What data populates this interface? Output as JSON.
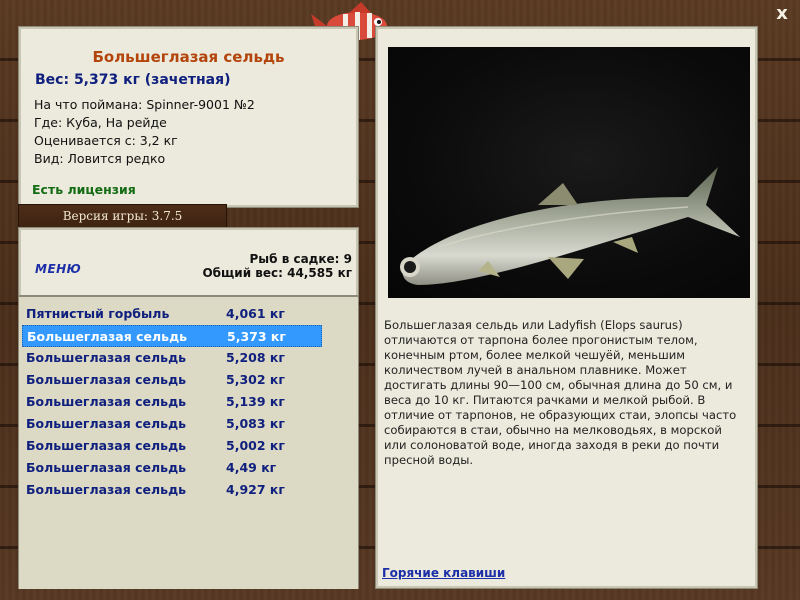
{
  "close_label": "x",
  "info": {
    "fish_name": "Большеглазая сельдь",
    "weight": "Вес: 5,373 кг (зачетная)",
    "lines": [
      "На что поймана: Spinner-9001 №2",
      "Где: Куба, На рейде",
      "Оценивается с: 3,2 кг",
      "Вид: Ловится редко"
    ],
    "license": "Есть лицензия"
  },
  "version": "Версия игры: 3.7.5",
  "menu_label": "МЕНЮ",
  "cage": {
    "count": "Рыб в садке: 9",
    "total": "Общий вес: 44,585 кг"
  },
  "catch_list": [
    {
      "name": "Пятнистый горбыль",
      "weight": "4,061 кг"
    },
    {
      "name": "Большеглазая сельдь",
      "weight": "5,373 кг"
    },
    {
      "name": "Большеглазая сельдь",
      "weight": "5,208 кг"
    },
    {
      "name": "Большеглазая сельдь",
      "weight": "5,302 кг"
    },
    {
      "name": "Большеглазая сельдь",
      "weight": "5,139 кг"
    },
    {
      "name": "Большеглазая сельдь",
      "weight": "5,083 кг"
    },
    {
      "name": "Большеглазая сельдь",
      "weight": "5,002 кг"
    },
    {
      "name": "Большеглазая сельдь",
      "weight": "4,49 кг"
    },
    {
      "name": "Большеглазая сельдь",
      "weight": "4,927 кг"
    }
  ],
  "selected_index": 1,
  "description": "Большеглазая сельдь или Ladyfish (Elops saurus) отличаются от тарпона более прогонистым телом, конечным ртом, более мелкой чешуёй, меньшим количеством лучей в анальном плавнике. Может достигать длины 90—100 см, обычная длина до 50 см, и веса до 10 кг. Питаются рачками и мелкой рыбой. В отличие от тарпонов, не образующих стаи, элопсы часто собираются в стаи, обычно на мелководьях, в морской или солоноватой воде, иногда заходя в реки до почти пресной воды.",
  "hotkeys_label": "Горячие клавиши",
  "colors": {
    "selected_row": "#3399ff",
    "title": "#b3440b",
    "link": "#1c2fa8"
  }
}
